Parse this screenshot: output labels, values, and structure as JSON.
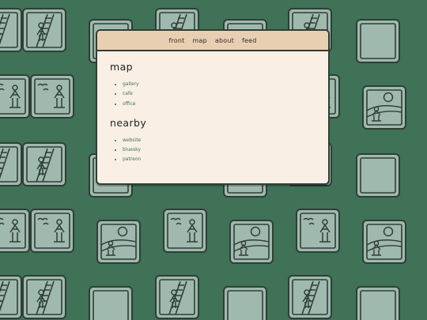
{
  "nav": {
    "items": [
      {
        "label": "front"
      },
      {
        "label": "map"
      },
      {
        "label": "about"
      },
      {
        "label": "feed"
      }
    ]
  },
  "sections": [
    {
      "heading": "map",
      "links": [
        {
          "label": "gallery"
        },
        {
          "label": "cafe"
        },
        {
          "label": "office"
        }
      ]
    },
    {
      "heading": "nearby",
      "links": [
        {
          "label": "website"
        },
        {
          "label": "bluesky"
        },
        {
          "label": "patreon"
        }
      ]
    }
  ],
  "colors": {
    "background": "#3f7257",
    "tile": "#a0b9af",
    "window": "#f9efe4",
    "nav": "#e9cfb1",
    "ink": "#2f3f36"
  },
  "background_icons": [
    "ladder-figure-icon",
    "birds-figure-icon",
    "sun-mountain-figure-icon",
    "blank-tile-icon"
  ]
}
